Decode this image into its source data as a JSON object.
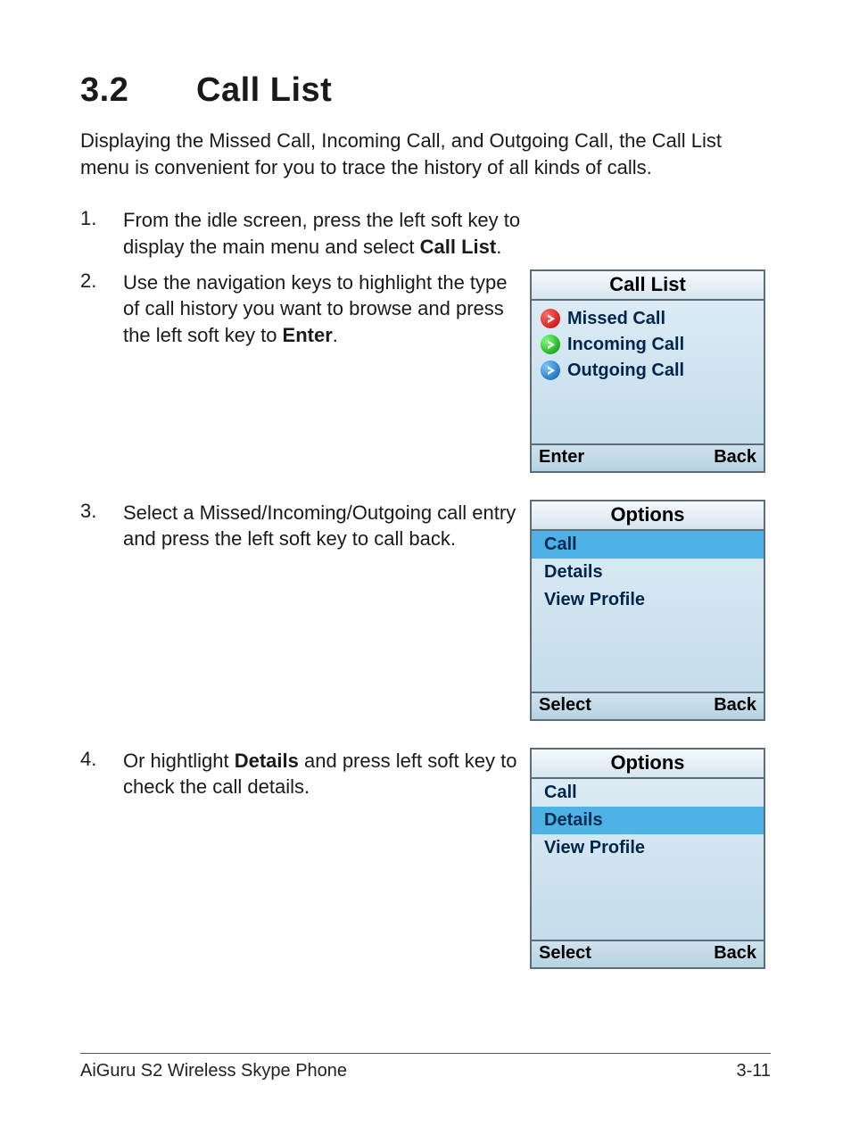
{
  "heading": {
    "number": "3.2",
    "title": "Call List"
  },
  "intro": "Displaying the Missed Call, Incoming Call, and Outgoing Call, the Call List menu is convenient for you to trace the history of all kinds of calls.",
  "steps": {
    "s1": {
      "num": "1.",
      "text_a": "From the idle screen, press the left soft key to display the main menu and select ",
      "bold_a": "Call List",
      "text_b": "."
    },
    "s2": {
      "num": "2.",
      "text_a": "Use the navigation keys to highlight the type of call history you want to browse and press the left soft key to ",
      "bold_a": "Enter",
      "text_b": "."
    },
    "s3": {
      "num": "3.",
      "text_a": "Select a Missed/Incoming/Outgoing call entry and press the left soft key to call back."
    },
    "s4": {
      "num": "4.",
      "text_a": "Or hightlight ",
      "bold_a": "Details",
      "text_b": " and press left soft key to check the call details."
    }
  },
  "screen1": {
    "title": "Call List",
    "items": [
      {
        "label": "Missed Call",
        "iconClass": "icon-red"
      },
      {
        "label": "Incoming Call",
        "iconClass": "icon-green"
      },
      {
        "label": "Outgoing Call",
        "iconClass": "icon-blue"
      }
    ],
    "left": "Enter",
    "right": "Back"
  },
  "screen2": {
    "title": "Options",
    "items": [
      {
        "label": "Call",
        "selected": true
      },
      {
        "label": "Details",
        "selected": false
      },
      {
        "label": "View Profile",
        "selected": false
      }
    ],
    "left": "Select",
    "right": "Back"
  },
  "screen3": {
    "title": "Options",
    "items": [
      {
        "label": "Call",
        "selected": false
      },
      {
        "label": "Details",
        "selected": true
      },
      {
        "label": "View Profile",
        "selected": false
      }
    ],
    "left": "Select",
    "right": "Back"
  },
  "footer": {
    "left": "AiGuru S2 Wireless Skype Phone",
    "right": "3-11"
  }
}
